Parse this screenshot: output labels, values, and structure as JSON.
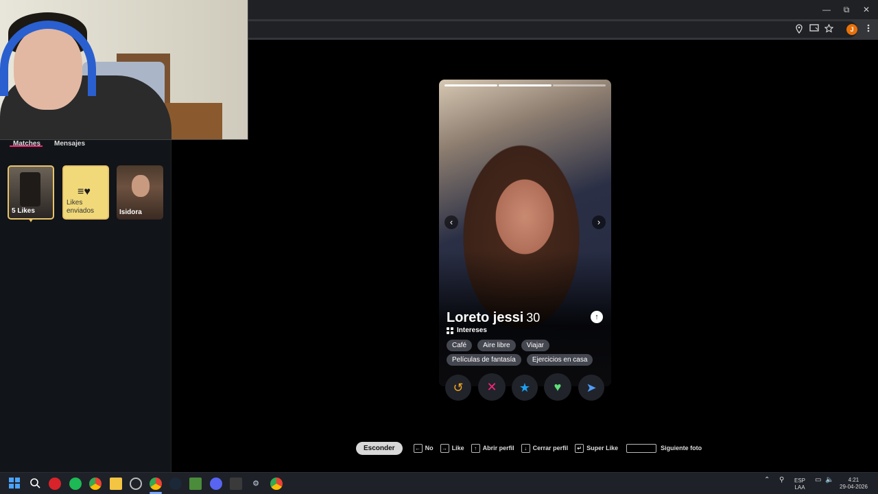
{
  "browser": {
    "window_controls": {
      "minimize": "—",
      "restore": "⧉",
      "close": "✕"
    },
    "profile_initial": "J",
    "toolbar_icons": [
      "location-icon",
      "cast-icon",
      "star-icon",
      "menu-icon"
    ]
  },
  "sidebar": {
    "tabs": [
      {
        "label": "Matches",
        "active": true
      },
      {
        "label": "Mensajes",
        "active": false
      }
    ],
    "match_cards": [
      {
        "label": "5 Likes",
        "type": "likes"
      },
      {
        "label": "Likes enviados",
        "type": "sent"
      },
      {
        "label": "Isidora",
        "type": "match"
      }
    ]
  },
  "profile": {
    "name": "Loreto jessi",
    "age": "30",
    "photo_count": 3,
    "active_photo_index": 1,
    "interests_title": "Intereses",
    "interests_row1": [
      "Café",
      "Aire libre",
      "Viajar"
    ],
    "interests_row2": [
      "Películas de fantasía",
      "Ejercicios en casa"
    ],
    "actions": [
      {
        "name": "rewind",
        "glyph": "↺",
        "color": "#f5a623"
      },
      {
        "name": "nope",
        "glyph": "✕",
        "color": "#fd267a"
      },
      {
        "name": "super-like",
        "glyph": "★",
        "color": "#1ca0f2"
      },
      {
        "name": "like",
        "glyph": "♥",
        "color": "#5ee07a"
      },
      {
        "name": "boost",
        "glyph": "➤",
        "color": "#4f9cf9"
      }
    ],
    "nav_prev": "‹",
    "nav_next": "›",
    "info_glyph": "↑"
  },
  "shortcuts": {
    "hide_label": "Esconder",
    "hints": [
      {
        "key": "←",
        "label": "No"
      },
      {
        "key": "→",
        "label": "Like"
      },
      {
        "key": "↑",
        "label": "Abrir perfil"
      },
      {
        "key": "↓",
        "label": "Cerrar perfil"
      },
      {
        "key": "↵",
        "label": "Super Like"
      },
      {
        "key": "space",
        "label": "Siguiente foto"
      }
    ]
  },
  "taskbar": {
    "lang_line1": "ESP",
    "lang_line2": "LAA",
    "time": "4:21",
    "date": "29-04-2026"
  }
}
